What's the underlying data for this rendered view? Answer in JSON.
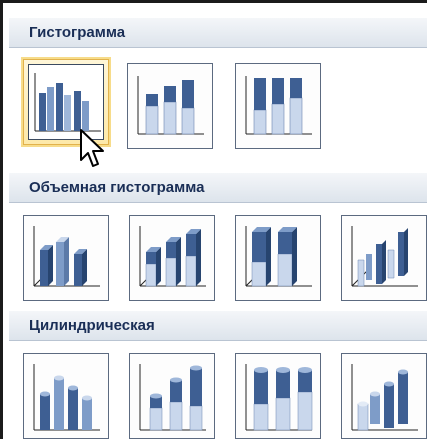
{
  "sections": [
    {
      "title": "Гистограмма"
    },
    {
      "title": "Объемная гистограмма"
    },
    {
      "title": "Цилиндрическая"
    }
  ],
  "colors": {
    "bar_dark": "#3e5f93",
    "bar_mid": "#7e9cc8",
    "bar_light": "#c9d7ec",
    "header_text": "#1a2e56",
    "selected_fill": "#fde9a9"
  },
  "icons": [
    "clustered-column-icon",
    "stacked-column-icon",
    "100-stacked-column-icon",
    "3d-clustered-column-icon",
    "3d-stacked-column-icon",
    "3d-100-stacked-column-icon",
    "3d-column-icon",
    "cylinder-clustered-icon",
    "cylinder-stacked-icon",
    "cylinder-100-stacked-icon",
    "cylinder-3d-icon"
  ]
}
